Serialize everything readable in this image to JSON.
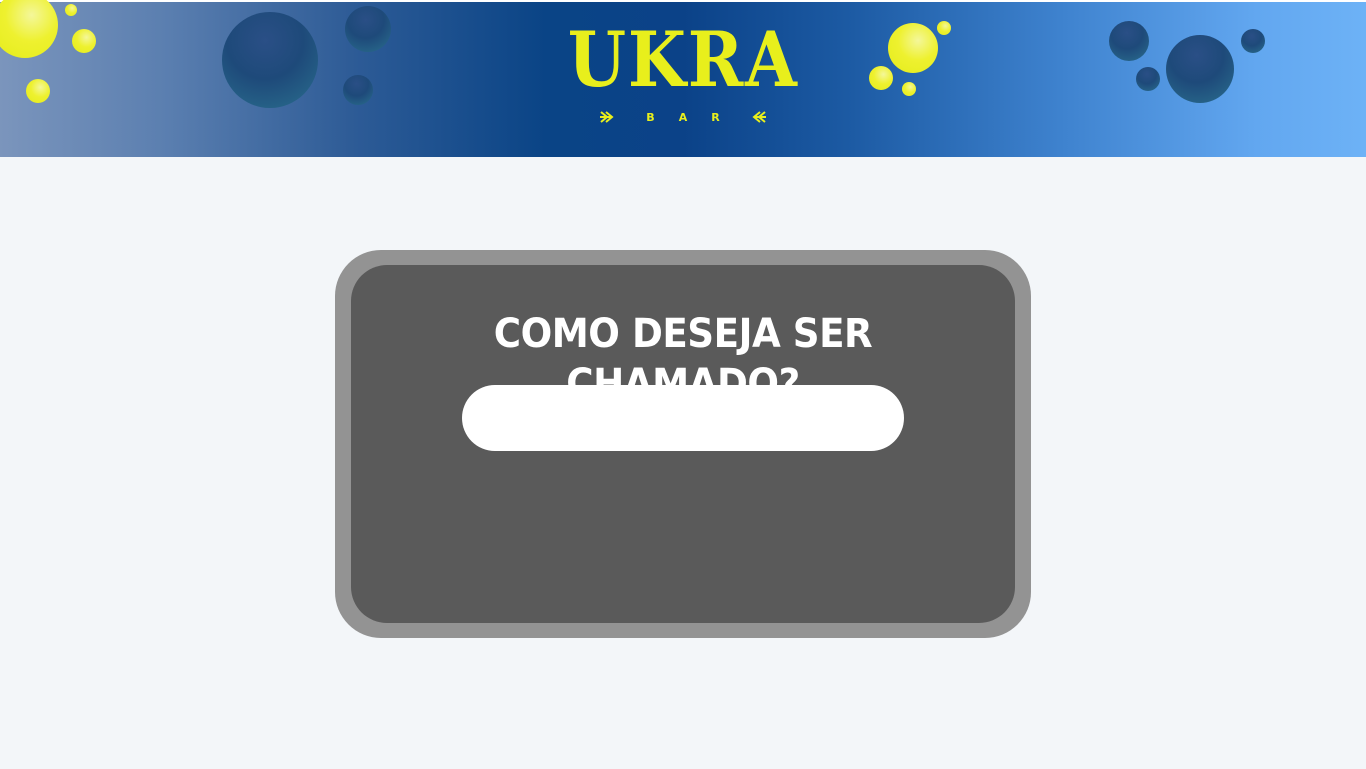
{
  "header": {
    "logo_text": "UKRA",
    "logo_subtext": [
      "B",
      "A",
      "R"
    ],
    "logo_color": "#e8ef1c",
    "gradient_colors": [
      "#7b95bc",
      "#0a4486",
      "#6db2f6"
    ]
  },
  "card": {
    "title": "COMO DESEJA SER CHAMADO?",
    "name_input": {
      "value": "",
      "placeholder": ""
    },
    "outer_color": "#939393",
    "inner_color": "#5a5a5a"
  },
  "background_color": "#f3f6f9"
}
